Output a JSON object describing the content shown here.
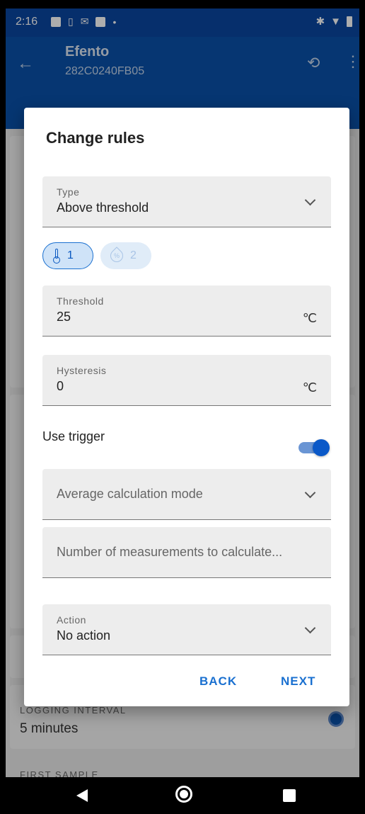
{
  "status": {
    "time": "2:16"
  },
  "appbar": {
    "title": "Efento",
    "subtitle": "282C0240FB05"
  },
  "background": {
    "logging_label": "LOGGING INTERVAL",
    "logging_value": "5 minutes",
    "first_sample_label": "FIRST SAMPLE"
  },
  "dialog": {
    "title": "Change rules",
    "type": {
      "label": "Type",
      "value": "Above threshold"
    },
    "chips": [
      {
        "value": "1",
        "icon": "thermometer-icon",
        "selected": true
      },
      {
        "value": "2",
        "icon": "humidity-icon",
        "selected": false
      }
    ],
    "threshold": {
      "label": "Threshold",
      "value": "25",
      "unit": "℃"
    },
    "hysteresis": {
      "label": "Hysteresis",
      "value": "0",
      "unit": "℃"
    },
    "use_trigger": {
      "label": "Use trigger",
      "on": true
    },
    "average_mode": {
      "placeholder": "Average calculation mode"
    },
    "num_measurements": {
      "placeholder": "Number of measurements to calculate..."
    },
    "action": {
      "label": "Action",
      "value": "No action"
    },
    "buttons": {
      "back": "BACK",
      "next": "NEXT"
    }
  },
  "colors": {
    "primary": "#0a50a8",
    "accent": "#1a70d0"
  }
}
